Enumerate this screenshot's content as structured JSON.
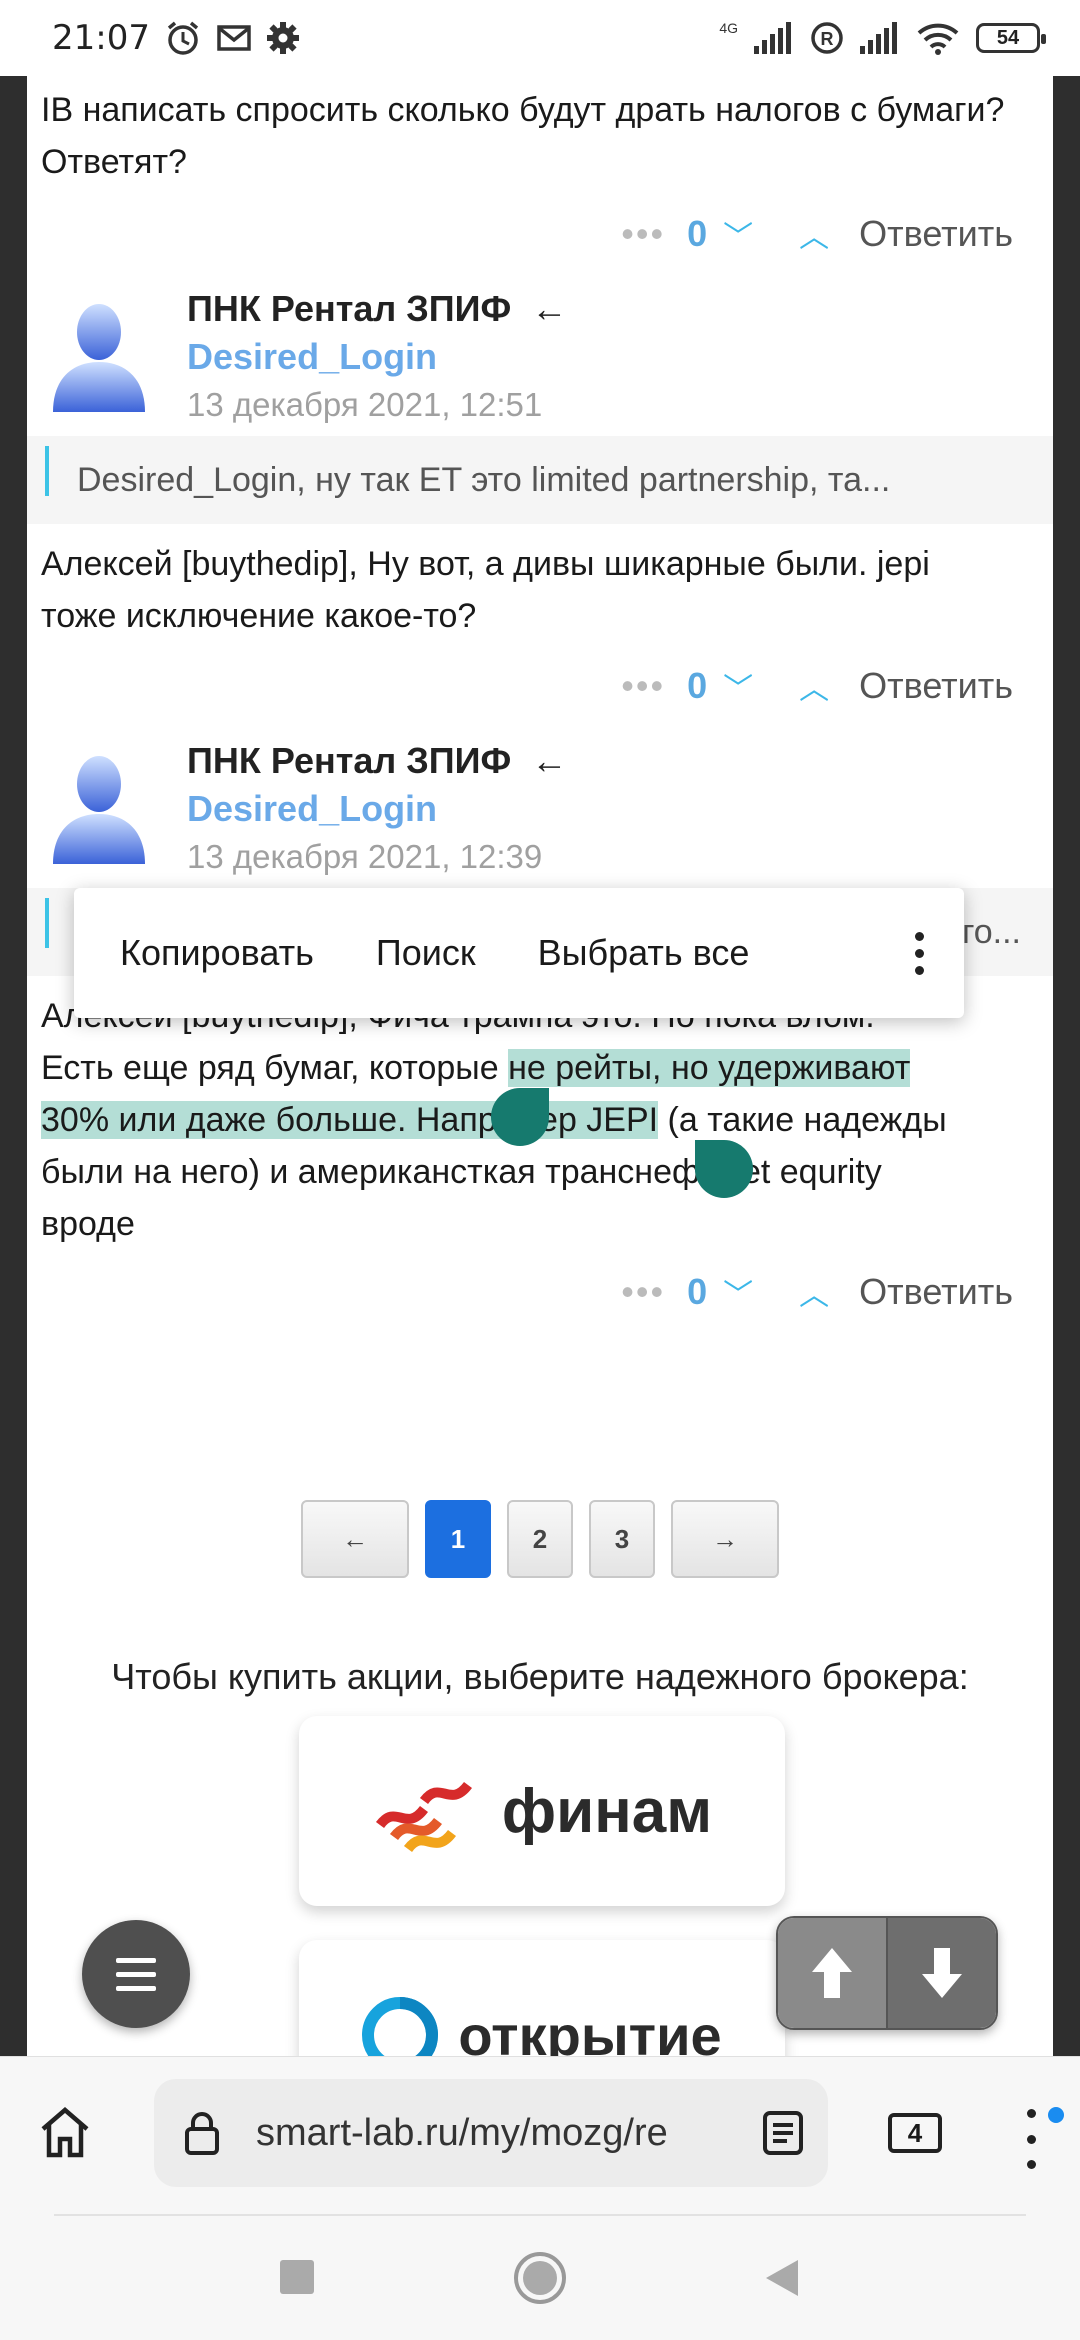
{
  "status": {
    "time": "21:07",
    "network": "4G",
    "battery": "54"
  },
  "comments": [
    {
      "tail_text": "IB написать спросить сколько будут драть налогов с бумаги? Ответят?",
      "votes": "0",
      "reply": "Ответить"
    },
    {
      "author": "ПНК Рентал ЗПИФ",
      "arrow": "←",
      "login": "Desired_Login",
      "date": "13 декабря 2021, 12:51",
      "quote": "Desired_Login, ну так ET это limited partnership, та...",
      "text": "Алексей [buythedip], Ну вот, а дивы шикарные были. jepi тоже исключение какое-то?",
      "votes": "0",
      "reply": "Ответить"
    },
    {
      "author": "ПНК Рентал ЗПИФ",
      "arrow": "←",
      "login": "Desired_Login",
      "date": "13 декабря 2021, 12:39",
      "quote_tail": "го...",
      "text_top": "Алексей [buythedip], Фича трампа это. Но пока влом.",
      "text_before_sel": "Есть еще ряд бумаг, которые ",
      "text_selected_1": "не рейты, но удерживают",
      "text_selected_2": "30% или даже больше. Например JEPI",
      "text_after_sel": " (а такие надежды",
      "text_line_4": "были на него) и американсткая транснефть et equrity",
      "text_line_5": "вроде",
      "votes": "0",
      "reply": "Ответить"
    }
  ],
  "selection_popup": {
    "copy": "Копировать",
    "search": "Поиск",
    "select_all": "Выбрать все"
  },
  "pagination": {
    "prev": "←",
    "pages": [
      "1",
      "2",
      "3"
    ],
    "active": "1",
    "next": "→"
  },
  "brokers": {
    "title": "Чтобы купить акции, выберите надежного брокера:",
    "items": [
      "финам",
      "открытие"
    ]
  },
  "browser": {
    "url": "smart-lab.ru/my/mozg/re",
    "tabs": "4"
  },
  "colors": {
    "accent_blue": "#3cb7e8",
    "login_blue": "#6aa9e8",
    "selection": "#b4ded6",
    "handle": "#167a6e",
    "active_page": "#1c6fe0"
  }
}
